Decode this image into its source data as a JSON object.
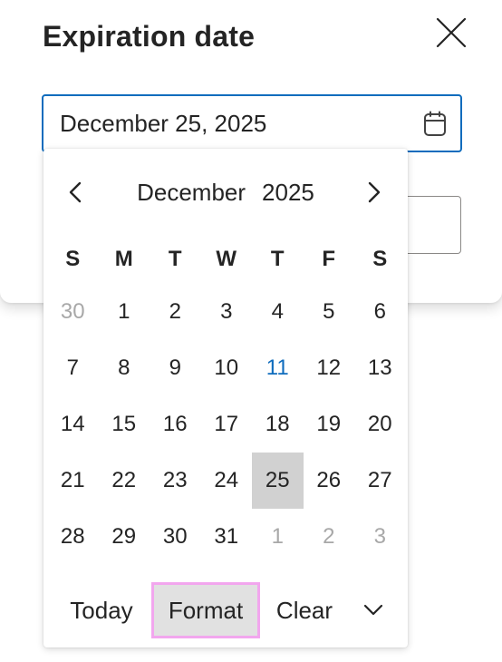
{
  "dialog": {
    "title": "Expiration date",
    "close_icon": "close-icon"
  },
  "date_input": {
    "value": "December 25, 2025",
    "calendar_icon": "calendar-icon"
  },
  "calendar": {
    "month": "December",
    "year": "2025",
    "prev_icon": "chevron-left-icon",
    "next_icon": "chevron-right-icon",
    "weekdays": [
      "S",
      "M",
      "T",
      "W",
      "T",
      "F",
      "S"
    ],
    "weeks": [
      [
        "30",
        "1",
        "2",
        "3",
        "4",
        "5",
        "6"
      ],
      [
        "7",
        "8",
        "9",
        "10",
        "11",
        "12",
        "13"
      ],
      [
        "14",
        "15",
        "16",
        "17",
        "18",
        "19",
        "20"
      ],
      [
        "21",
        "22",
        "23",
        "24",
        "25",
        "26",
        "27"
      ],
      [
        "28",
        "29",
        "30",
        "31",
        "1",
        "2",
        "3"
      ]
    ],
    "today": "11",
    "selected": "25",
    "colors": {
      "accent": "#0f6cbd",
      "selected_bg": "#d1d1d1",
      "other_month_text": "#a8a8a8",
      "focus_outline": "#f2a6ee"
    }
  },
  "footer": {
    "today_label": "Today",
    "format_label": "Format",
    "clear_label": "Clear",
    "expand_icon": "chevron-down-icon"
  }
}
